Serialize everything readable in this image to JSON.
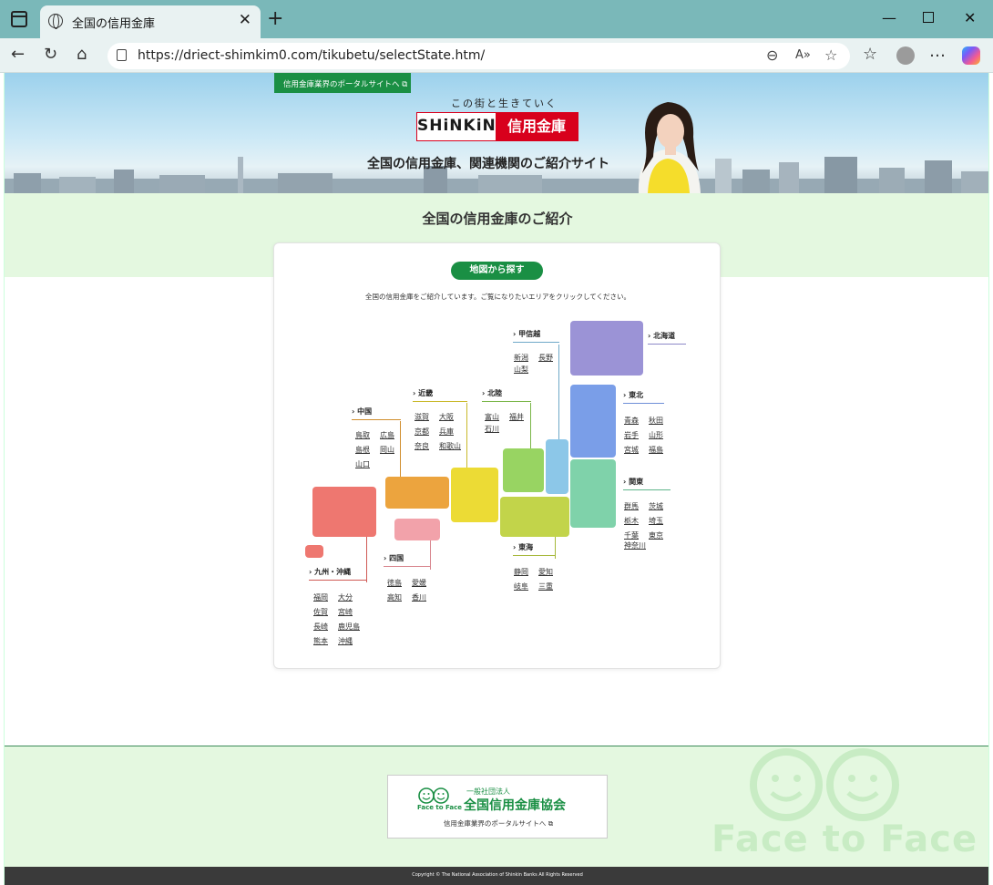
{
  "browser": {
    "tab_title": "全国の信用金庫",
    "url": "https://driect-shimkim0.com/tikubetu/selectState.htm/"
  },
  "hero": {
    "portal_tag": "信用金庫業界のポータルサイトへ ⧉",
    "tagline": "この街と生きていく",
    "logo_en": "SHiNKiN",
    "logo_jp": "信用金庫",
    "subtitle": "全国の信用金庫、関連機関のご紹介サイト"
  },
  "main": {
    "section_title": "全国の信用金庫のご紹介",
    "map_pill": "地図から探す",
    "intro": "全国の信用金庫をご紹介しています。ご覧になりたいエリアをクリックしてください。"
  },
  "regions": {
    "hokkaido": {
      "label": "北海道",
      "prefs": []
    },
    "tohoku": {
      "label": "東北",
      "prefs": [
        "青森",
        "秋田",
        "岩手",
        "山形",
        "宮城",
        "福島"
      ]
    },
    "koshinetsu": {
      "label": "甲信越",
      "prefs": [
        "新潟",
        "長野",
        "山梨"
      ]
    },
    "hokuriku": {
      "label": "北陸",
      "prefs": [
        "富山",
        "福井",
        "石川"
      ]
    },
    "kanto": {
      "label": "関東",
      "prefs": [
        "群馬",
        "茨城",
        "栃木",
        "埼玉",
        "千葉",
        "東京",
        "神奈川"
      ]
    },
    "tokai": {
      "label": "東海",
      "prefs": [
        "静岡",
        "愛知",
        "岐阜",
        "三重"
      ]
    },
    "kinki": {
      "label": "近畿",
      "prefs": [
        "滋賀",
        "大阪",
        "京都",
        "兵庫",
        "奈良",
        "和歌山"
      ]
    },
    "chugoku": {
      "label": "中国",
      "prefs": [
        "鳥取",
        "広島",
        "島根",
        "岡山",
        "山口"
      ]
    },
    "shikoku": {
      "label": "四国",
      "prefs": [
        "徳島",
        "愛媛",
        "高知",
        "香川"
      ]
    },
    "kyushu": {
      "label": "九州・沖縄",
      "prefs": [
        "福岡",
        "大分",
        "佐賀",
        "宮崎",
        "長崎",
        "鹿児島",
        "熊本",
        "沖縄"
      ]
    }
  },
  "colors": {
    "hokkaido": "#9b93d6",
    "tohoku": "#7a9ee8",
    "kanto": "#7fd2aa",
    "koshinetsu": "#8cc7e8",
    "hokuriku": "#98d462",
    "tokai": "#c2d44a",
    "kinki": "#ecdb35",
    "chugoku": "#eca43e",
    "shikoku": "#f2a2aa",
    "kyushu": "#ee7770",
    "brand_green": "#1a8f44",
    "brand_red": "#d8001c"
  },
  "footer": {
    "org_small": "一般社団法人",
    "org_name": "全国信用金庫協会",
    "face_to_face": "Face to Face",
    "portal_link": "信用金庫業界のポータルサイトへ ⧉",
    "watermark": "Face to Face",
    "copyright": "Copyright © The National Association of Shinkin Banks All Rights Reserved"
  }
}
